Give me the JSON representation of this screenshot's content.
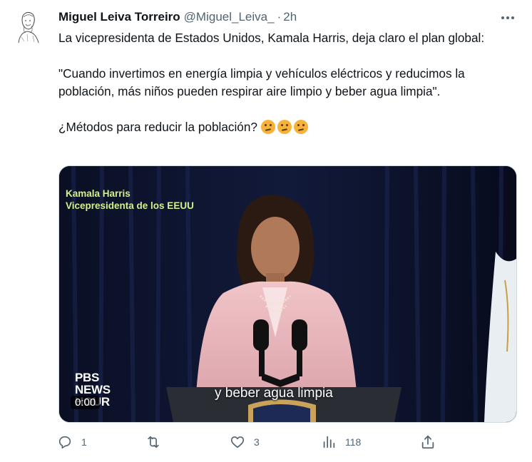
{
  "tweet": {
    "author_name": "Miguel Leiva Torreiro",
    "handle": "@Miguel_Leiva_",
    "separator": "·",
    "time": "2h",
    "text_p1": "La vicepresidenta de Estados Unidos, Kamala Harris, deja claro el plan global:",
    "text_p2": "\"Cuando invertimos en energía limpia y vehículos eléctricos y reducimos la población, más niños pueden respirar aire limpio y beber agua limpia\".",
    "text_p3": "¿Métodos para reducir la población?",
    "emojis": [
      "thinking-face-icon",
      "thinking-face-icon",
      "thinking-face-icon"
    ]
  },
  "video": {
    "caption_line1": "Kamala Harris",
    "caption_line2": "Vicepresidenta de los EEUU",
    "subtitle": "y beber agua limpia",
    "logo_line1": "PBS",
    "logo_line2": "NEWS",
    "logo_line3": "HOUR",
    "timestamp": "0:00"
  },
  "actions": {
    "reply_count": "1",
    "retweet_count": "",
    "like_count": "3",
    "views_count": "118"
  },
  "colors": {
    "text": "#0f1419",
    "secondary": "#536471",
    "caption": "#d4f08a"
  }
}
